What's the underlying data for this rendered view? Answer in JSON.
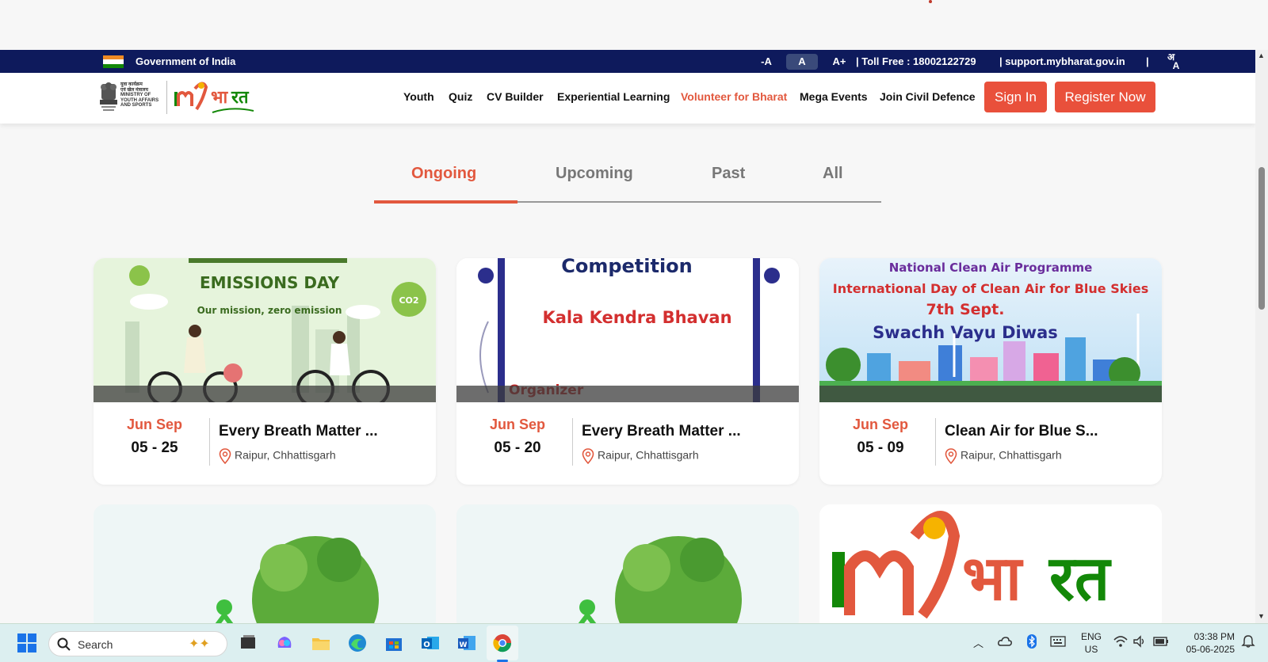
{
  "gov_bar": {
    "government_label": "Government of India",
    "font_decrease": "-A",
    "font_normal": "A",
    "font_increase": "A+",
    "toll_free": "| Toll Free : 18002122729",
    "support": "| support.mybharat.gov.in",
    "divider": "|"
  },
  "header": {
    "ministry_lines": [
      "युवा कार्यक्रम",
      "एवं खेल मंत्रालय",
      "MINISTRY OF",
      "YOUTH AFFAIRS",
      "AND SPORTS"
    ],
    "nav": [
      "Youth",
      "Quiz",
      "CV Builder",
      "Experiential Learning",
      "Volunteer for Bharat",
      "Mega Events",
      "Join Civil Defence"
    ],
    "sign_in": "Sign In",
    "register": "Register Now"
  },
  "tabs": [
    "Ongoing",
    "Upcoming",
    "Past",
    "All"
  ],
  "cards": [
    {
      "months": "Jun Sep",
      "days": "05 - 25",
      "title": "Every Breath Matter ...",
      "location": "Raipur, Chhattisgarh",
      "banner": {
        "line1": "EMISSIONS DAY",
        "line2": "Our mission, zero emission",
        "badge": "CO2"
      }
    },
    {
      "months": "Jun Sep",
      "days": "05 - 20",
      "title": "Every Breath Matter ...",
      "location": "Raipur, Chhattisgarh",
      "banner": {
        "line1": "Competition",
        "line2": "Kala Kendra Bhavan",
        "line3": "Organizer"
      }
    },
    {
      "months": "Jun Sep",
      "days": "05 - 09",
      "title": "Clean Air for Blue S...",
      "location": "Raipur, Chhattisgarh",
      "banner": {
        "line1": "National Clean Air Programme",
        "line2": "International Day of Clean Air for Blue Skies",
        "line3": "7th Sept.",
        "line4": "Swachh Vayu Diwas"
      }
    }
  ],
  "taskbar": {
    "search_placeholder": "Search",
    "lang": "ENG",
    "region": "US",
    "time": "03:38 PM",
    "date": "05-06-2025"
  },
  "colors": {
    "accent": "#e2583e",
    "gov_bar": "#0e1a5c",
    "button": "#e9503b"
  }
}
